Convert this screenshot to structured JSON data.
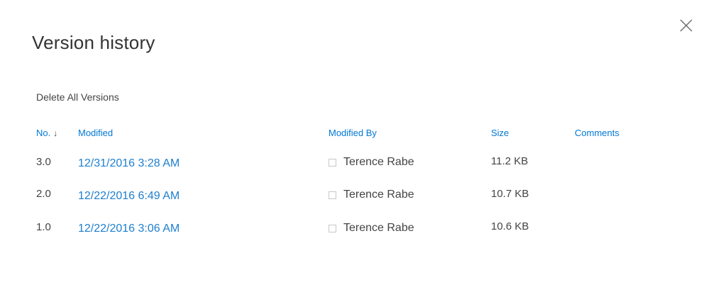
{
  "dialog": {
    "title": "Version history",
    "delete_all_label": "Delete All Versions"
  },
  "table": {
    "headers": {
      "no": "No.",
      "modified": "Modified",
      "modified_by": "Modified By",
      "size": "Size",
      "comments": "Comments"
    },
    "sort_indicator": "↓",
    "rows": [
      {
        "no": "3.0",
        "modified": "12/31/2016 3:28 AM",
        "modified_by": "Terence Rabe",
        "size": "11.2 KB",
        "comments": ""
      },
      {
        "no": "2.0",
        "modified": "12/22/2016 6:49 AM",
        "modified_by": "Terence Rabe",
        "size": "10.7 KB",
        "comments": ""
      },
      {
        "no": "1.0",
        "modified": "12/22/2016 3:06 AM",
        "modified_by": "Terence Rabe",
        "size": "10.6 KB",
        "comments": ""
      }
    ]
  },
  "icons": {
    "close": "close-icon",
    "sort": "arrow-down-icon"
  },
  "colors": {
    "link": "#1e7fce",
    "header_link": "#0078d4",
    "text": "#444444"
  }
}
